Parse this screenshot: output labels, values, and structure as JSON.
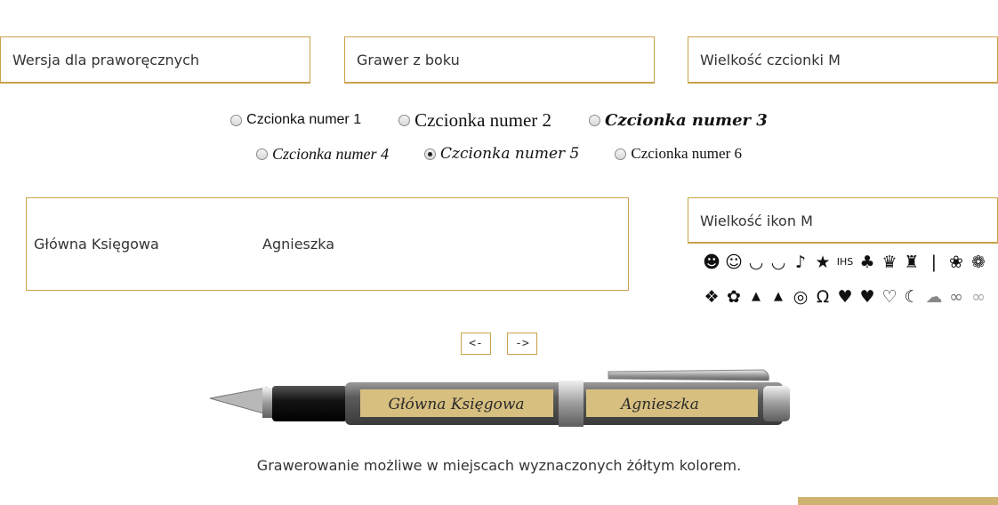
{
  "selects": {
    "hand": "Wersja dla praworęcznych",
    "engrave_side": "Grawer z boku",
    "font_size": "Wielkość czcionki M",
    "icon_size": "Wielkość ikon M"
  },
  "fonts": {
    "f1": "Czcionka numer 1",
    "f2": "Czcionka numer 2",
    "f3": "Czcionka numer 3",
    "f4": "Czcionka numer 4",
    "f5": "Czcionka numer 5",
    "f6": "Czcionka numer 6",
    "selected": "f5"
  },
  "engraving": {
    "text_left": "Główna Księgowa",
    "text_right": "Agnieszka"
  },
  "icons": {
    "row1": [
      "☻",
      "☺",
      "◡",
      "◡",
      "♪",
      "★",
      "IHS",
      "♣",
      "♛",
      "♜",
      "❘",
      "❀",
      "❁"
    ],
    "row2": [
      "❖",
      "✿",
      "▲",
      "▲",
      "◎",
      "Ω",
      "♥",
      "♥",
      "♡",
      "☾",
      "☁",
      "∞",
      "∞"
    ]
  },
  "nav": {
    "prev": "<-",
    "next": "->"
  },
  "pen": {
    "label_left": "Główna Księgowa",
    "label_right": "Agnieszka"
  },
  "note": "Grawerowanie możliwe w miejscach wyznaczonych żółtym kolorem.",
  "colors": {
    "gold": "#c9a24a",
    "label_gold": "#d7bf80"
  }
}
